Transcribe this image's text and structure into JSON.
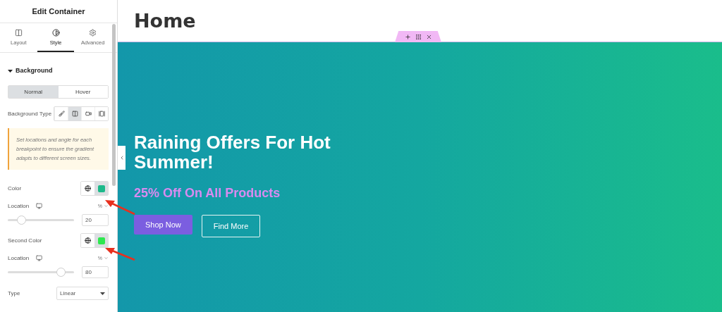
{
  "panel": {
    "title": "Edit Container",
    "tabs": [
      {
        "label": "Layout",
        "selected": false
      },
      {
        "label": "Style",
        "selected": true
      },
      {
        "label": "Advanced",
        "selected": false
      }
    ],
    "section": {
      "title": "Background",
      "expanded": true
    },
    "state_tabs": [
      {
        "label": "Normal",
        "selected": true
      },
      {
        "label": "Hover",
        "selected": false
      }
    ],
    "background_type": {
      "label": "Background Type",
      "options": [
        {
          "selected": false
        },
        {
          "selected": true
        },
        {
          "selected": false
        },
        {
          "selected": false
        }
      ]
    },
    "notice": "Set locations and angle for each breakpoint to ensure the gradient adapts to different screen sizes.",
    "controls": [
      {
        "kind": "color",
        "label": "Color",
        "color": "#1cb98a"
      },
      {
        "kind": "location",
        "label": "Location",
        "unit": "%",
        "level": 0.2,
        "value": "20"
      },
      {
        "kind": "color",
        "label": "Second Color",
        "color": "#2ee84f"
      },
      {
        "kind": "location",
        "label": "Location",
        "unit": "%",
        "level": 0.8,
        "value": "80"
      },
      {
        "kind": "select",
        "label": "Type",
        "value": "Linear"
      }
    ]
  },
  "page": {
    "title": "Home",
    "hero": {
      "heading": "Raining Offers For Hot Summer!",
      "subheading": "25% Off On All Products",
      "buttons": [
        {
          "label": "Shop Now",
          "kind": "primary"
        },
        {
          "label": "Find More",
          "kind": "outline"
        }
      ]
    }
  }
}
